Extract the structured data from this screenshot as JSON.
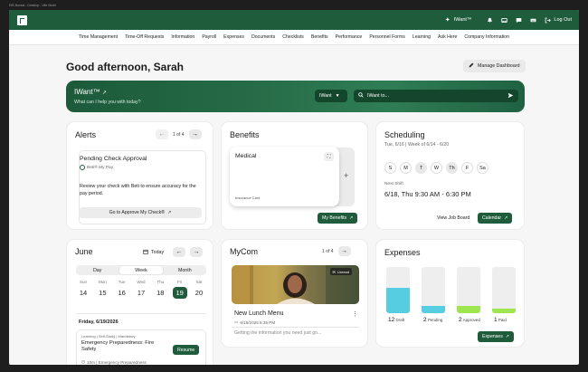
{
  "window_title": "EIB Bonsai - Desktop - Vite Mode",
  "topbar": {
    "iwant_label": "IWant™",
    "logout_label": "Log Out"
  },
  "nav": [
    "Time Management",
    "Time-Off Requests",
    "Information",
    "Payroll",
    "Expenses",
    "Documents",
    "Checklists",
    "Benefits",
    "Performance",
    "Personnel Forms",
    "Learning",
    "Ask Here",
    "Company Information"
  ],
  "greeting": "Good afternoon, Sarah",
  "manage_dashboard": "Manage Dashboard",
  "hero": {
    "title": "IWant™",
    "subtitle": "What can I help you with today?",
    "dropdown": "IWant",
    "placeholder": "IWant to..."
  },
  "alerts": {
    "title": "Alerts",
    "pager": "1 of 4",
    "item_title": "Pending Check Approval",
    "source": "Beti® My Pay",
    "body": "Review your check with Beti to ensure accuracy for the pay period.",
    "action": "Go to Approve My Check®"
  },
  "benefits": {
    "title": "Benefits",
    "card_title": "Medical",
    "card_sub": "Insurance Card",
    "button": "My Benefits"
  },
  "scheduling": {
    "title": "Scheduling",
    "date": "Tue, 6/16 | Week of 6/14 - 6/20",
    "days": [
      "S",
      "M",
      "T",
      "W",
      "Th",
      "F",
      "Sa"
    ],
    "next_label": "Next Shift",
    "next_shift": "6/18, Thu 9:30 AM - 6:30 PM",
    "job_board": "View Job Board",
    "calendar": "Calendar"
  },
  "calendar": {
    "month": "June",
    "today_label": "Today",
    "views": [
      "Day",
      "Week",
      "Month"
    ],
    "active_view": "Week",
    "week": [
      {
        "n": "Sun",
        "d": "14"
      },
      {
        "n": "Mon",
        "d": "15"
      },
      {
        "n": "Tue",
        "d": "16"
      },
      {
        "n": "Wed",
        "d": "17"
      },
      {
        "n": "Thu",
        "d": "18"
      },
      {
        "n": "Fri",
        "d": "19"
      },
      {
        "n": "Sat",
        "d": "20"
      }
    ],
    "today_index": 5,
    "selected_date": "Friday, 6/19/2026",
    "event_meta": "Learning | Self-Study | Mandatory",
    "event_title": "Emergency Preparedness: Fire Safety",
    "event_info": "10m | Emergency Preparedness",
    "resume": "Resume"
  },
  "mycom": {
    "title": "MyCom",
    "pager": "1 of 4",
    "badge": "Unread",
    "post_title": "New Lunch Menu",
    "post_date": "6/15/2026 5:35 PM",
    "excerpt": "Getting the information you need just go..."
  },
  "expenses": {
    "title": "Expenses",
    "button": "Expenses",
    "bars": [
      {
        "count": "12",
        "label": "Draft",
        "level": 0.55,
        "color": "#56cde0"
      },
      {
        "count": "2",
        "label": "Pending",
        "level": 0.15,
        "color": "#56cde0"
      },
      {
        "count": "2",
        "label": "Approved",
        "level": 0.15,
        "color": "#9ee64f"
      },
      {
        "count": "1",
        "label": "Paid",
        "level": 0.1,
        "color": "#9ee64f"
      }
    ]
  }
}
